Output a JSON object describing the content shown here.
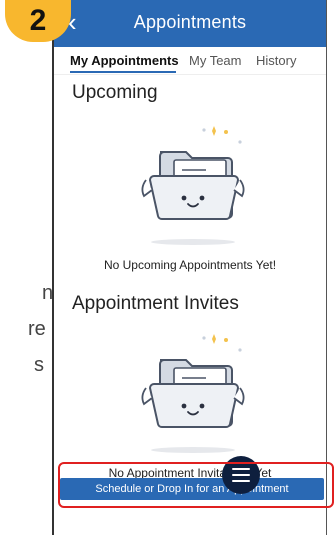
{
  "step": {
    "number": "2"
  },
  "side_text": {
    "line1": "n",
    "line2": "re",
    "line3": "s"
  },
  "appbar": {
    "back_icon": "chevron-left-icon",
    "title": "Appointments"
  },
  "tabs": [
    {
      "label": "My Appointments",
      "active": true
    },
    {
      "label": "My Team",
      "active": false
    },
    {
      "label": "History",
      "active": false
    }
  ],
  "sections": {
    "upcoming": {
      "title": "Upcoming",
      "empty_message": "No Upcoming Appointments Yet!"
    },
    "invites": {
      "title": "Appointment Invites",
      "empty_message": "No Appointment Invitations Yet"
    }
  },
  "actions": {
    "schedule_label": "Schedule or Drop In for an Appointment",
    "menu_icon": "menu-icon"
  },
  "colors": {
    "primary": "#2a69b4",
    "fab": "#0e1f3e",
    "badge": "#f8b72e",
    "highlight": "#e02020"
  }
}
